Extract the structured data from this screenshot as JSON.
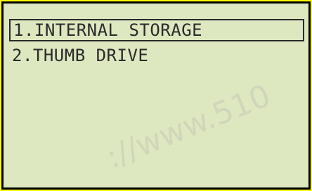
{
  "menu": {
    "items": [
      {
        "label": "1.INTERNAL STORAGE",
        "selected": true
      },
      {
        "label": "2.THUMB DRIVE",
        "selected": false
      }
    ]
  },
  "watermark": "://www.510",
  "colors": {
    "outer_background": "#ffff00",
    "screen_background": "#dde8c0",
    "text": "#2a2a2a",
    "border": "#000000"
  }
}
